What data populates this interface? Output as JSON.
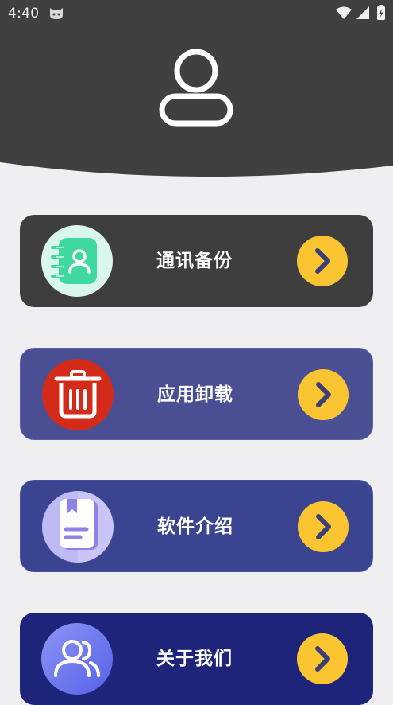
{
  "status_bar": {
    "time": "4:40",
    "icons": [
      "cat-app-icon",
      "wifi-icon",
      "signal-icon",
      "battery-icon"
    ]
  },
  "header": {
    "icon": "user-icon",
    "background_color": "#404040"
  },
  "menu": [
    {
      "label": "通讯备份",
      "icon": "contacts-backup-icon",
      "color": "#3e3e3e"
    },
    {
      "label": "应用卸载",
      "icon": "trash-icon",
      "color": "#4a4f94"
    },
    {
      "label": "软件介绍",
      "icon": "book-icon",
      "color": "#3b4490"
    },
    {
      "label": "关于我们",
      "icon": "users-icon",
      "color": "#1d2479"
    }
  ],
  "colors": {
    "accent_arrow": "#fbc531",
    "page_background": "#efeff1"
  }
}
